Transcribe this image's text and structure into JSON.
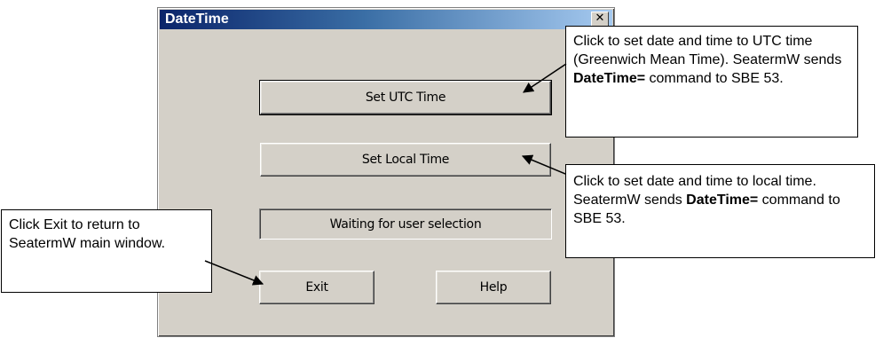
{
  "window": {
    "title": "DateTime",
    "close_glyph": "✕"
  },
  "buttons": {
    "set_utc": "Set UTC Time",
    "set_local": "Set Local Time",
    "exit": "Exit",
    "help": "Help"
  },
  "status": {
    "text": "Waiting for user selection"
  },
  "callouts": {
    "utc": {
      "text_before": "Click to set date and time to UTC time (Greenwich Mean Time). SeatermW sends ",
      "bold": "DateTime=",
      "text_after": " command to SBE 53."
    },
    "local": {
      "text_before": "Click to set date and time to local time. SeatermW sends ",
      "bold": "DateTime=",
      "text_after": " command to SBE 53."
    },
    "exit": {
      "text": "Click Exit to return to SeatermW main window."
    }
  }
}
